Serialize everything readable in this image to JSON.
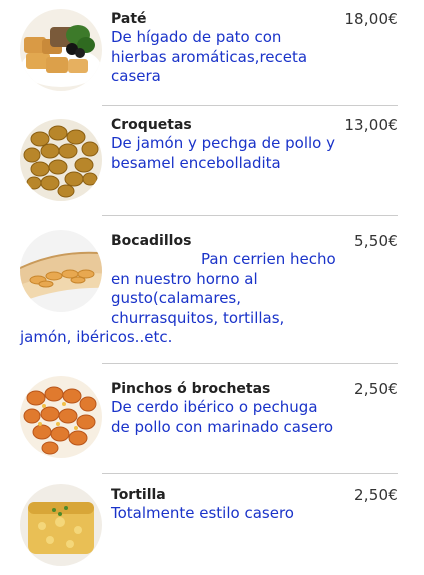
{
  "menu": {
    "items": [
      {
        "name": "Paté",
        "description": "De hígado de pato con hierbas aromáticas,receta casera",
        "price": "18,00€",
        "image_icon": "pate-toast-image"
      },
      {
        "name": "Croquetas",
        "description": "De jamón y pechga de pollo y besamel encebolladita",
        "price": "13,00€",
        "image_icon": "croquetas-image"
      },
      {
        "name": "Bocadillos",
        "description": "Pan cerrien hecho en nuestro horno al gusto(calamares, churrasquitos, tortillas, jamón, ibéricos..etc.",
        "price": "5,50€",
        "image_icon": "sandwich-image"
      },
      {
        "name": "Pinchos ó brochetas",
        "description": "De cerdo ibérico o pechuga de pollo con marinado casero",
        "price": "2,50€",
        "image_icon": "skewers-image"
      },
      {
        "name": "Tortilla",
        "description": "Totalmente estilo casero",
        "price": "2,50€",
        "image_icon": "tortilla-image"
      }
    ]
  },
  "colors": {
    "name": "#222222",
    "description": "#1a33c9",
    "price": "#333333",
    "divider": "#cccccc"
  }
}
